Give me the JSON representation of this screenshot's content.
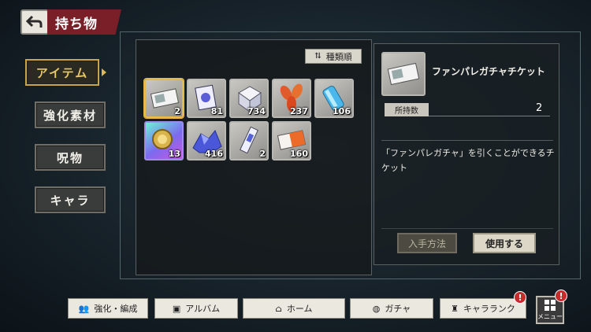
{
  "header": {
    "title": "持ち物"
  },
  "sidebar": {
    "tabs": [
      {
        "label": "アイテム",
        "active": true
      },
      {
        "label": "強化素材",
        "active": false
      },
      {
        "label": "呪物",
        "active": false
      },
      {
        "label": "キャラ",
        "active": false
      }
    ]
  },
  "sort": {
    "label": "種類順"
  },
  "items": [
    {
      "icon": "ticket-icon",
      "count": "2",
      "selected": true
    },
    {
      "icon": "card-icon",
      "count": "81"
    },
    {
      "icon": "dice-icon",
      "count": "734"
    },
    {
      "icon": "leaf-icon",
      "count": "237"
    },
    {
      "icon": "crystal-icon",
      "count": "106"
    },
    {
      "icon": "medal-icon",
      "count": "13",
      "rarity": "purple"
    },
    {
      "icon": "ore-icon",
      "count": "416"
    },
    {
      "icon": "charm-icon",
      "count": "2"
    },
    {
      "icon": "orange-ticket-icon",
      "count": "160"
    }
  ],
  "detail": {
    "name": "ファンパレガチャチケット",
    "owned_label": "所持数",
    "owned_value": "2",
    "description": "「ファンパレガチャ」を引くことができるチケット",
    "obtain_label": "入手方法",
    "use_label": "使用する"
  },
  "bottom_nav": [
    {
      "label": "強化・編成",
      "icon": "team-icon"
    },
    {
      "label": "アルバム",
      "icon": "album-icon"
    },
    {
      "label": "ホーム",
      "icon": "home-icon"
    },
    {
      "label": "ガチャ",
      "icon": "gacha-icon"
    },
    {
      "label": "キャラランク",
      "icon": "rank-icon",
      "badge": "!"
    }
  ],
  "menu": {
    "label": "メニュー",
    "badge": "!"
  }
}
